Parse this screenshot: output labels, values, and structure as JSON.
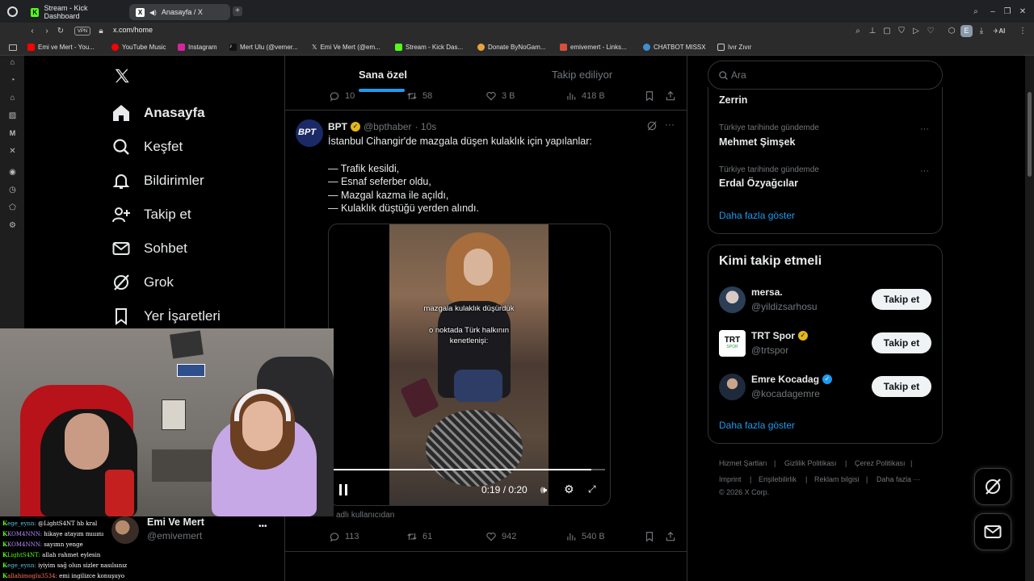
{
  "browser": {
    "tabs": [
      {
        "label": "Stream - Kick Dashboard",
        "active": false
      },
      {
        "label": "Anasayfa / X",
        "active": true
      }
    ],
    "url": "x.com/home",
    "vpn_label": "VPN",
    "bookmarks": [
      "Emi ve Mert - You...",
      "YouTube Music",
      "Instagram",
      "Mert Ulu (@vemer...",
      "Emi Ve Mert (@em...",
      "Stream - Kick Das...",
      "Donate ByNoGam...",
      "emivemert - Links...",
      "CHATBOT MISSX",
      "Ivır Zıvır"
    ],
    "profile_initial": "E",
    "ai_label": "AI"
  },
  "nav": {
    "items": [
      {
        "label": "Anasayfa",
        "icon": "home-icon"
      },
      {
        "label": "Keşfet",
        "icon": "search-icon"
      },
      {
        "label": "Bildirimler",
        "icon": "bell-icon"
      },
      {
        "label": "Takip et",
        "icon": "add-user-icon"
      },
      {
        "label": "Sohbet",
        "icon": "mail-icon"
      },
      {
        "label": "Grok",
        "icon": "grok-icon"
      },
      {
        "label": "Yer İşaretleri",
        "icon": "bookmark-icon"
      }
    ],
    "account": {
      "name": "Emi Ve Mert",
      "handle": "@emivemert",
      "more": "•••"
    }
  },
  "timeline": {
    "tabs": [
      "Sana özel",
      "Takip ediliyor"
    ],
    "prev_metrics": {
      "replies": "10",
      "reposts": "58",
      "likes": "3 B",
      "views": "418 B"
    },
    "post": {
      "author": "BPT",
      "handle": "@bpthaber",
      "time": "· 10s",
      "avatar_text": "BPT",
      "title": "İstanbul Cihangir'de mazgala düşen kulaklık için yapılanlar:",
      "lines": [
        "— Trafik kesildi,",
        "— Esnaf seferber oldu,",
        "— Mazgal kazma ile açıldı,",
        "— Kulaklık düştüğü yerden alındı."
      ],
      "video": {
        "caption1": "mazgala kulaklık düşürdük",
        "caption2": "o noktada Türk halkının",
        "caption3": "kenetlenişi:",
        "time": "0:19 / 0:20",
        "progress": 0.95
      },
      "source": "adlı kullanıcıdan",
      "metrics": {
        "replies": "113",
        "reposts": "61",
        "likes": "942",
        "views": "540 B"
      }
    }
  },
  "right": {
    "search_placeholder": "Ara",
    "trends": [
      {
        "context": "",
        "title": "Zerrin"
      },
      {
        "context": "Türkiye tarihinde gündemde",
        "title": "Mehmet Şimşek"
      },
      {
        "context": "Türkiye tarihinde gündemde",
        "title": "Erdal Özyağcılar"
      }
    ],
    "trends_more": "Daha fazla göster",
    "follow": {
      "title": "Kimi takip etmeli",
      "accounts": [
        {
          "name": "mersa.",
          "handle": "@yildizsarhosu",
          "verified": false,
          "button": "Takip et"
        },
        {
          "name": "TRT Spor",
          "handle": "@trtspor",
          "verified": "gold",
          "button": "Takip et",
          "avatar_text": "TRT",
          "avatar_sub": "SPOR"
        },
        {
          "name": "Emre Kocadag",
          "handle": "@kocadagemre",
          "verified": "blue",
          "button": "Takip et"
        }
      ],
      "more": "Daha fazla göster"
    },
    "footer": [
      "Hizmet Şartları",
      "Gizlilik Politikası",
      "Çerez Politikası",
      "Imprint",
      "Erişilebilirlik",
      "Reklam bilgisi",
      "Daha fazla ···",
      "© 2026 X Corp."
    ]
  },
  "stream": {
    "chat": [
      {
        "user": "ege_eynn:",
        "msg": "@LightS4NT hb kral"
      },
      {
        "user": "KOM4NNN:",
        "msg": "hikaye atayım mıııını"
      },
      {
        "user": "KOM4NNN:",
        "msg": "sayımn yenge"
      },
      {
        "user": "LightS4NT:",
        "msg": "allah rahmet eylesin"
      },
      {
        "user": "ege_eynn:",
        "msg": "iyiyim sağ olun sizler nasılsınız"
      },
      {
        "user": "allahimoglu3534:",
        "msg": "emi ingilizce konuşuyo"
      }
    ]
  },
  "colors": {
    "accent": "#1d9bf0",
    "gold": "#e2b719",
    "kick_green": "#53fc18"
  }
}
